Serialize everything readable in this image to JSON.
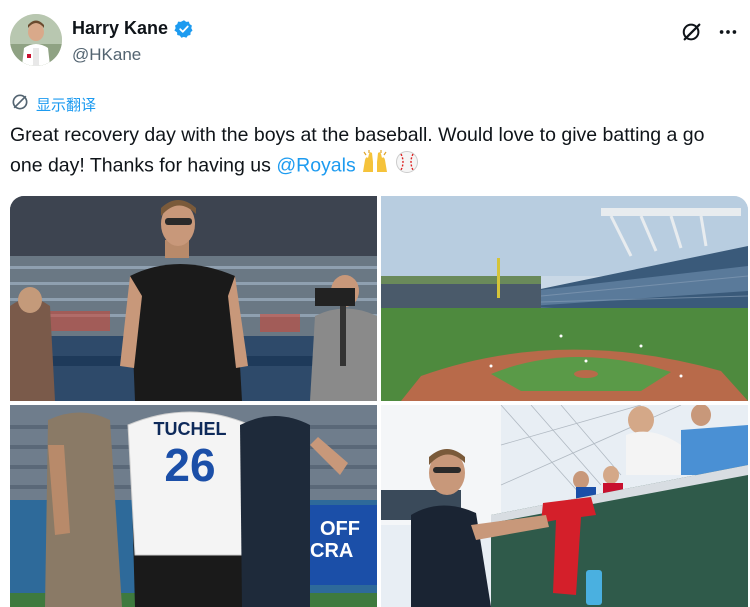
{
  "user": {
    "display_name": "Harry Kane",
    "handle": "@HKane",
    "verified": true,
    "verified_color": "#1d9bf0"
  },
  "header_icons": [
    "grok-icon",
    "more-icon"
  ],
  "translate": {
    "label": "显示翻译",
    "icon": "translate-icon"
  },
  "tweet": {
    "text_before": "Great recovery day with the boys at the baseball. Would love to give batting a go one day! Thanks for having us ",
    "mention": "@Royals",
    "emojis": [
      "raising-hands",
      "baseball"
    ]
  },
  "photos": {
    "jersey_name": "TUCHEL",
    "jersey_number": "26",
    "board_text_1": "OFF",
    "board_text_2": "CRA"
  },
  "colors": {
    "link": "#1d9bf0",
    "text": "#0f1419",
    "secondary": "#536471",
    "royals_blue": "#1b4fa8"
  }
}
